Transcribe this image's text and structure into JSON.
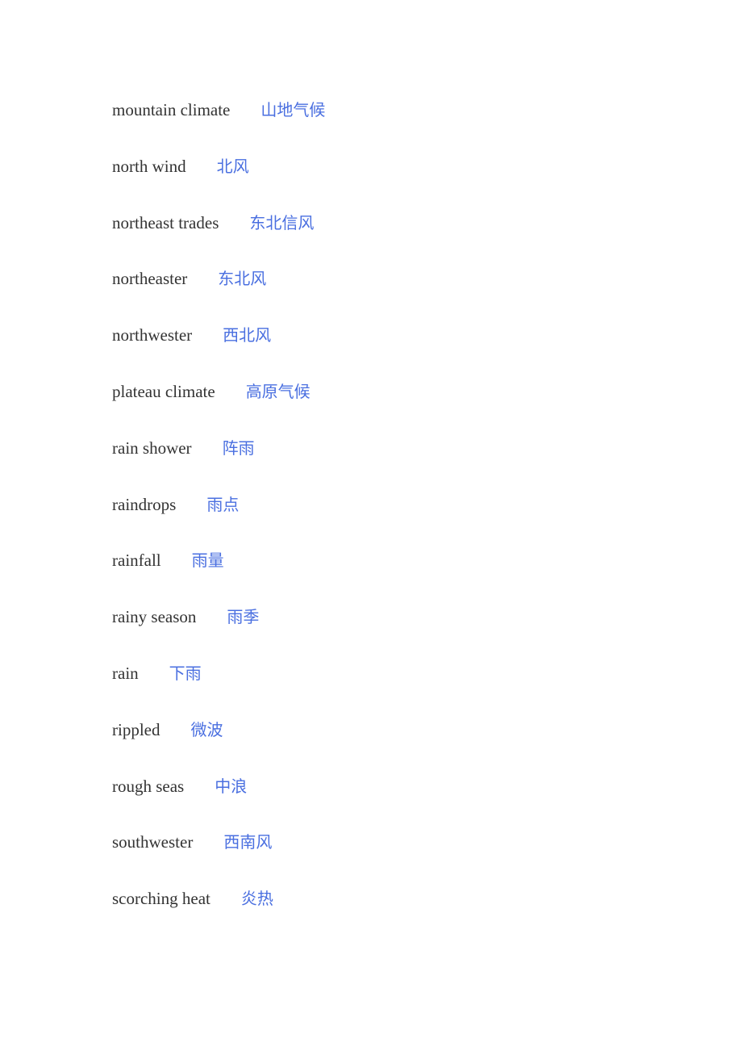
{
  "document": {
    "entries": [
      {
        "en": "mountain climate",
        "zh": "山地气候"
      },
      {
        "en": "north wind",
        "zh": "北风"
      },
      {
        "en": "northeast trades",
        "zh": "东北信风"
      },
      {
        "en": "northeaster",
        "zh": "东北风"
      },
      {
        "en": "northwester",
        "zh": "西北风"
      },
      {
        "en": "plateau climate",
        "zh": "高原气候"
      },
      {
        "en": "rain shower",
        "zh": "阵雨"
      },
      {
        "en": "raindrops",
        "zh": "雨点"
      },
      {
        "en": "rainfall",
        "zh": "雨量"
      },
      {
        "en": "rainy season",
        "zh": "雨季"
      },
      {
        "en": "rain",
        "zh": "下雨"
      },
      {
        "en": "rippled",
        "zh": "微波"
      },
      {
        "en": "rough seas",
        "zh": "中浪"
      },
      {
        "en": "southwester",
        "zh": "西南风"
      },
      {
        "en": "scorching heat",
        "zh": "炎热"
      }
    ],
    "colors": {
      "english": "#333333",
      "chinese": "#4a6fe0"
    }
  }
}
